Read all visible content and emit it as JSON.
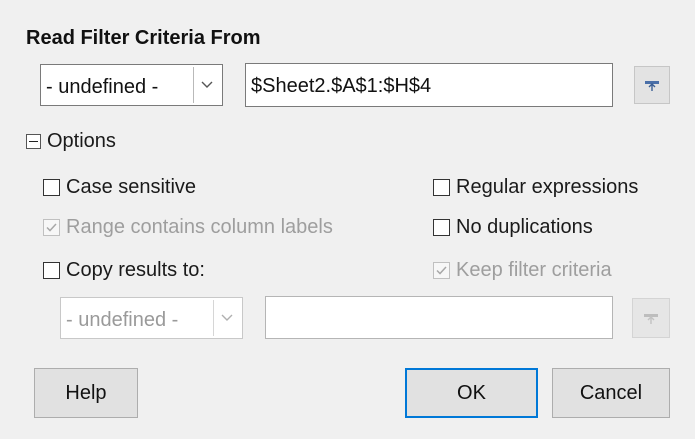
{
  "header": {
    "title": "Read Filter Criteria From"
  },
  "source": {
    "select_value": "- undefined -",
    "range_value": "$Sheet2.$A$1:$H$4"
  },
  "options": {
    "label": "Options",
    "case_sensitive": {
      "label": "Case sensitive",
      "checked": false
    },
    "regular_expressions": {
      "label": "Regular expressions",
      "checked": false
    },
    "range_contains_column_labels": {
      "label": "Range contains column labels",
      "checked": true,
      "enabled": false
    },
    "no_duplications": {
      "label": "No duplications",
      "checked": false
    },
    "copy_results_to": {
      "label": "Copy results to:",
      "checked": false
    },
    "keep_filter_criteria": {
      "label": "Keep filter criteria",
      "checked": true,
      "enabled": false
    },
    "copy_target_select_value": "- undefined -",
    "copy_target_value": ""
  },
  "buttons": {
    "help": "Help",
    "ok": "OK",
    "cancel": "Cancel"
  },
  "colors": {
    "default_button_border": "#0078d7",
    "background": "#f0f0f0"
  }
}
